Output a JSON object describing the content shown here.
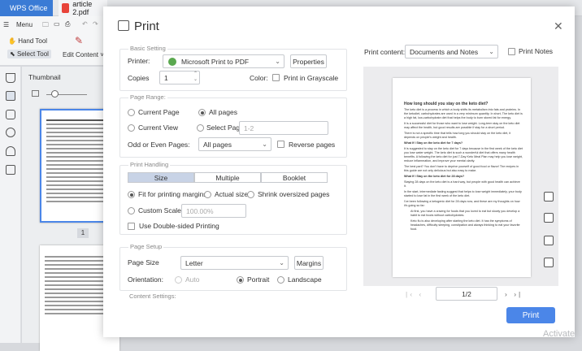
{
  "tabs": {
    "wps": "WPS Office",
    "doc": "article 2.pdf"
  },
  "toolbar": {
    "menu": "Menu",
    "hand_tool": "Hand Tool",
    "select_tool": "Select Tool",
    "edit_content": "Edit Content"
  },
  "sidebar": {
    "thumbnail": "Thumbnail",
    "page_num": "1"
  },
  "dialog": {
    "title": "Print",
    "basic": {
      "title": "Basic Setting",
      "printer_label": "Printer:",
      "printer_value": "Microsoft Print to PDF",
      "properties": "Properties",
      "copies_label": "Copies",
      "copies_value": "1",
      "color_label": "Color:",
      "grayscale": "Print in Grayscale"
    },
    "range": {
      "title": "Page Range:",
      "current_page": "Current Page",
      "all_pages": "All pages",
      "current_view": "Current View",
      "select_page": "Select Page:",
      "select_placeholder": "1-2",
      "odd_even_label": "Odd or Even Pages:",
      "odd_even_value": "All pages",
      "reverse": "Reverse pages"
    },
    "handling": {
      "title": "Print Handling",
      "seg_size": "Size",
      "seg_multiple": "Multiple",
      "seg_booklet": "Booklet",
      "fit": "Fit for printing margins",
      "actual": "Actual size",
      "shrink": "Shrink oversized pages",
      "custom": "Custom Scale:",
      "custom_value": "100.00%",
      "duplex": "Use Double-sided Printing"
    },
    "setup": {
      "title": "Page Setup",
      "page_size_label": "Page Size",
      "page_size_value": "Letter",
      "margins": "Margins",
      "orientation_label": "Orientation:",
      "auto": "Auto",
      "portrait": "Portrait",
      "landscape": "Landscape"
    },
    "content_settings": "Content Settings:",
    "print_content_label": "Print content:",
    "print_content_value": "Documents and Notes",
    "print_notes": "Print Notes",
    "preview_page": "1/2",
    "print_button": "Print",
    "watermark": "Activate"
  },
  "preview_doc": {
    "heading": "How long should you stay on the keto diet?",
    "p1": "The keto diet is a process in which a body shifts its metabolism into fats and proteins. In the ketodiet, carbohydrates are used in a very minimum quantity. In short, The keto diet is a high fat, low-carbohydrate diet that helps the body to burn stored fat for energy.",
    "p2": "It is a successful diet for those who want to lose weight. Long-term stay on the keto diet may affect the health, but good results are possible if stay for a short period.",
    "p3": "There is not a specific time that tells how long you should stay on the keto diet, it depends on people's weight and health.",
    "h2": "What  If I Stay on the keto diet for 7 days?",
    "p4": "It is suggested to stay on the keto diet for 7 days because in the first week of the keto diet you lose water weight. The keto diet is such a wonderful diet that offers many health benefits. A following the keto diet for just 7-Day Keto Meal Plan may help you lose weight, reduce inflammation, and improve your mental clarity.",
    "p5": "The best part? You don't have to deprive yourself of good food or flavor! The recipes in this guide are not only delicious but also easy to make.",
    "h3": "What If I Stay on the keto diet for 28 days?",
    "p6": "Staying 28 days on the keto diet is a hard way, but people with good health can achieve it.",
    "p7": "In the start, intermediate fasting suggest that helps to lose weight immediately, your body started to lose fat in the first week of the keto diet.",
    "p8": "I've been following a ketogenic diet for 28 days now, and these are my thoughts on how it's going so far:",
    "b1": "At first, you have a craving for foods that you loved to eat but slowly you develop a habit to eat foods without carbohydrates.",
    "b2": "Keto flu is also developing after starting the keto diet. It has the symptoms of headaches, difficulty sleeping, constipation and always thinking to eat your favorite food."
  }
}
